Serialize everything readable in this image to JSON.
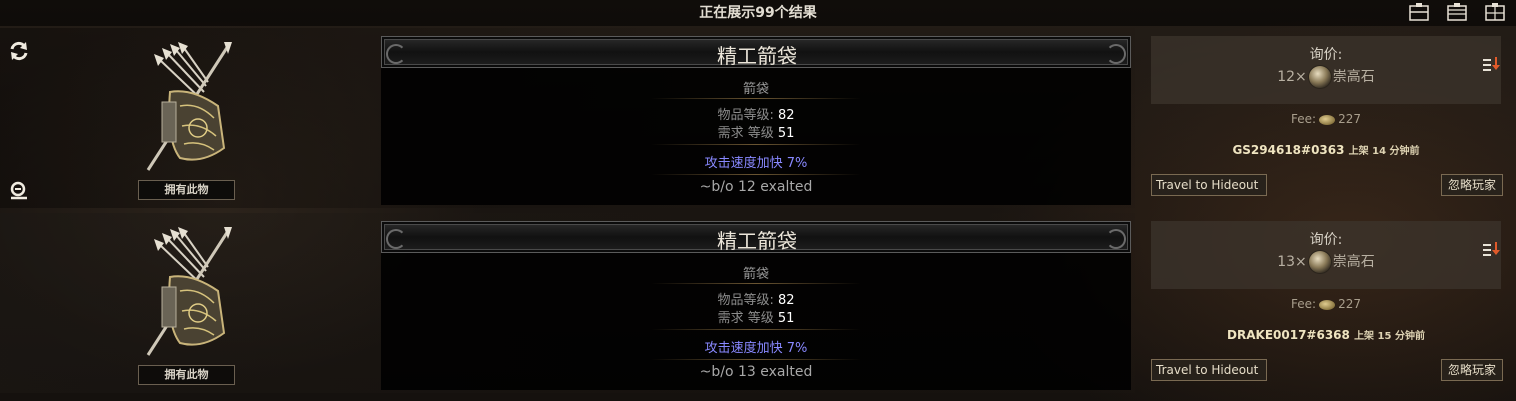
{
  "header": {
    "result_count": "正在展示99个结果"
  },
  "listings": [
    {
      "item_name": "精工箭袋",
      "item_type": "箭袋",
      "properties": [
        {
          "label": "物品等级:",
          "value": "82"
        },
        {
          "label": "需求 等级",
          "value": "51"
        }
      ],
      "mod": "攻击速度加快 7%",
      "note": "~b/o 12 exalted",
      "owned_label": "拥有此物",
      "price_label": "询价:",
      "price_amount": "12×",
      "currency": "崇高石",
      "fee_label": "Fee:",
      "fee_value": "227",
      "seller": "GS294618#0363",
      "listed": "上架 14 分钟前",
      "hideout_label": "Travel to Hideout",
      "ignore_label": "忽略玩家"
    },
    {
      "item_name": "精工箭袋",
      "item_type": "箭袋",
      "properties": [
        {
          "label": "物品等级:",
          "value": "82"
        },
        {
          "label": "需求 等级",
          "value": "51"
        }
      ],
      "mod": "攻击速度加快 7%",
      "note": "~b/o 13 exalted",
      "owned_label": "拥有此物",
      "price_label": "询价:",
      "price_amount": "13×",
      "currency": "崇高石",
      "fee_label": "Fee:",
      "fee_value": "227",
      "seller": "DRAKE0017#6368",
      "listed": "上架 15 分钟前",
      "hideout_label": "Travel to Hideout",
      "ignore_label": "忽略玩家"
    }
  ],
  "icons": {
    "refresh": "refresh-icon",
    "search": "search-zoom-icon",
    "views": [
      "view-list-icon",
      "view-detail-icon",
      "view-grid-icon"
    ],
    "sort": "sort-price-icon"
  },
  "colors": {
    "mod_text": "#8888ff",
    "seller_text": "#efe4c0",
    "panel_bg": "#000000"
  }
}
